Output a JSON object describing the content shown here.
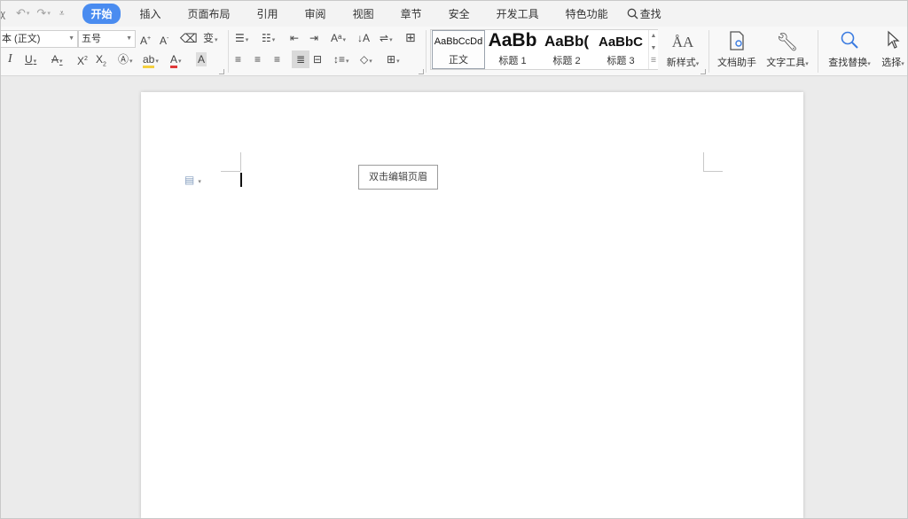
{
  "quick_access": {
    "cut_icon": "scissors-icon",
    "undo_icon": "undo-icon",
    "redo_icon": "redo-icon",
    "customize_icon": "customize-quick-access-icon"
  },
  "menu": {
    "tabs": [
      {
        "label": "开始",
        "active": true
      },
      {
        "label": "插入"
      },
      {
        "label": "页面布局"
      },
      {
        "label": "引用"
      },
      {
        "label": "审阅"
      },
      {
        "label": "视图"
      },
      {
        "label": "章节"
      },
      {
        "label": "安全"
      },
      {
        "label": "开发工具"
      },
      {
        "label": "特色功能"
      }
    ],
    "search_label": "查找"
  },
  "ribbon": {
    "font_name": "本 (正文)",
    "font_size": "五号",
    "styles": [
      {
        "preview": "AaBbCcDd",
        "label": "正文"
      },
      {
        "preview": "AaBb",
        "label": "标题 1"
      },
      {
        "preview": "AaBb(",
        "label": "标题 2"
      },
      {
        "preview": "AaBbC",
        "label": "标题 3"
      }
    ],
    "new_style_label": "新样式",
    "doc_assistant_label": "文档助手",
    "text_tools_label": "文字工具",
    "find_replace_label": "查找替换",
    "select_label": "选择"
  },
  "document": {
    "header_hint": "双击编辑页眉"
  },
  "colors": {
    "accent": "#4a8cf0",
    "font_color_underline": "#e03a3a",
    "highlight_underline": "#f4d03f"
  }
}
